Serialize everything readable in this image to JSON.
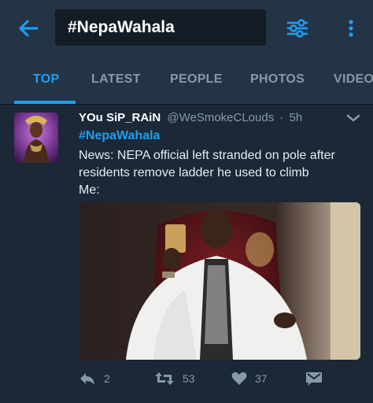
{
  "search": {
    "query": "#NepaWahala"
  },
  "tabs": [
    {
      "label": "TOP",
      "active": true
    },
    {
      "label": "LATEST",
      "active": false
    },
    {
      "label": "PEOPLE",
      "active": false
    },
    {
      "label": "PHOTOS",
      "active": false
    },
    {
      "label": "VIDEOS",
      "active": false
    }
  ],
  "tweet": {
    "display_name": "YOu SiP_RAiN",
    "handle": "@WeSmokeCLouds",
    "separator": "·",
    "time": "5h",
    "hashtag": "#NepaWahala",
    "body_lines": [
      "News: NEPA official left stranded on pole after residents remove ladder he used to climb",
      "Me:"
    ],
    "actions": {
      "reply_count": "2",
      "retweet_count": "53",
      "like_count": "37"
    }
  },
  "colors": {
    "header_bg": "#243447",
    "tweet_bg": "#1b2836",
    "accent": "#1da1f2",
    "muted": "#8899a6"
  },
  "icons": [
    "back-arrow-icon",
    "filter-sliders-icon",
    "more-vertical-icon",
    "chevron-down-icon",
    "reply-icon",
    "retweet-icon",
    "heart-icon",
    "direct-message-icon"
  ]
}
